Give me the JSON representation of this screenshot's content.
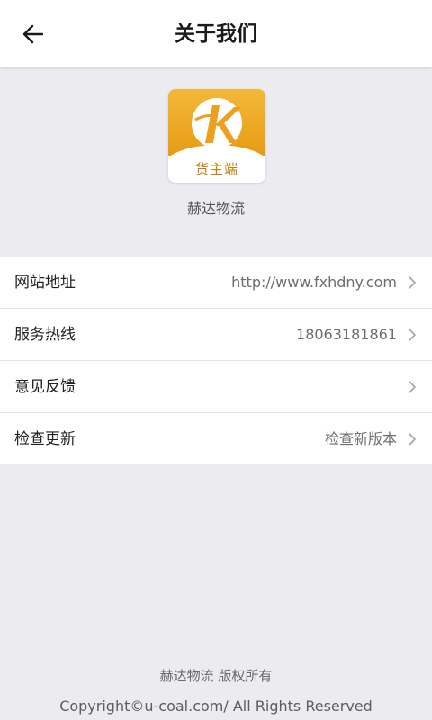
{
  "header": {
    "title": "关于我们",
    "back_icon": "arrow-left-icon"
  },
  "app": {
    "logo_icon": "k-logo-icon",
    "logo_caption": "货主端",
    "brand_color": "#EBA11F",
    "company_name": "赫达物流"
  },
  "list": {
    "items": [
      {
        "label": "网站地址",
        "value": "http://www.fxhdny.com"
      },
      {
        "label": "服务热线",
        "value": "18063181861"
      },
      {
        "label": "意见反馈",
        "value": ""
      },
      {
        "label": "检查更新",
        "value": "检查新版本"
      }
    ],
    "chevron_icon": "chevron-right-icon"
  },
  "footer": {
    "owner": "赫达物流 版权所有",
    "copyright": "Copyright©u-coal.com/ All Rights Reserved"
  }
}
